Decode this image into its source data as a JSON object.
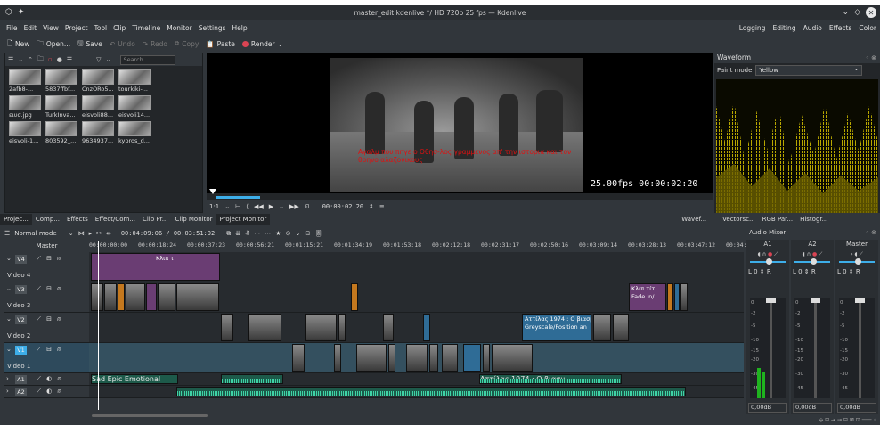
{
  "window": {
    "title": "master_edit.kdenlive */ HD 720p 25 fps — Kdenlive"
  },
  "menu": [
    "File",
    "Edit",
    "View",
    "Project",
    "Tool",
    "Clip",
    "Timeline",
    "Monitor",
    "Settings",
    "Help"
  ],
  "layouts": [
    "Logging",
    "Editing",
    "Audio",
    "Effects",
    "Color"
  ],
  "toolbar": {
    "new": "New",
    "open": "Open...",
    "save": "Save",
    "undo": "Undo",
    "redo": "Redo",
    "copy": "Copy",
    "paste": "Paste",
    "render": "Render"
  },
  "bin": {
    "search_placeholder": "Search...",
    "clips": [
      "2afb8-...",
      "5837ffbf...",
      "CnzORo5...",
      "tourkiki-...",
      "ειυσ.jpg",
      "TurkInva...",
      "eisvoli88...",
      "eisvoli14...",
      "eisvoli-1...",
      "803592_...",
      "9634937...",
      "kypros_d..."
    ]
  },
  "monitor": {
    "subtitle": "Αγαλμ που πηγε ο Οθησ-λος γραμμενος απ' την ιστορια και τον θρηνο αλαζονικους",
    "fps_timecode": "25.00fps 00:00:02:20",
    "zoom": "1:1",
    "timecode": "00:00:02:20"
  },
  "waveform": {
    "title": "Waveform",
    "paint_mode_label": "Paint mode",
    "paint_mode_value": "Yellow"
  },
  "dock_tabs": [
    "Projec...",
    "Comp...",
    "Effects",
    "Effect/Com...",
    "Clip Pr...",
    "Clip Monitor",
    "Project Monitor"
  ],
  "scope_tabs": [
    "Wavef...",
    "Vectorsc...",
    "RGB Par...",
    "Histogr..."
  ],
  "timeline": {
    "mode": "Normal mode",
    "position": "00:04:09:06 / 00:03:51:02",
    "master_label": "Master",
    "ruler": [
      "00:00:00:00",
      "00:00:18:24",
      "00:00:37:23",
      "00:00:56:21",
      "00:01:15:21",
      "00:01:34:19",
      "00:01:53:18",
      "00:02:12:18",
      "00:02:31:17",
      "00:02:50:16",
      "00:03:09:14",
      "00:03:28:13",
      "00:03:47:12",
      "00:04:"
    ],
    "tracks": [
      {
        "tag": "V4",
        "name": "Video 4"
      },
      {
        "tag": "V3",
        "name": "Video 3"
      },
      {
        "tag": "V2",
        "name": "Video 2"
      },
      {
        "tag": "V1",
        "name": "Video 1"
      },
      {
        "tag": "A1",
        "name": ""
      },
      {
        "tag": "A2",
        "name": ""
      }
    ],
    "clip_labels": {
      "v4_title": "Κλιπ τ",
      "v3_title": "Κλιπ τίτ",
      "v3_fade": "Fade in/",
      "v2_title": "Αττίλας 1974 : Ο βιασμ",
      "v2_effect": "Greyscale/Position an",
      "a1_music": "Sad Epic Emotional Musi",
      "a1_voice": "Αττίλας 1974 : Ο βιασμ"
    }
  },
  "mixer": {
    "title": "Audio Mixer",
    "strips": [
      {
        "name": "A1",
        "db": "0,00dB"
      },
      {
        "name": "A2",
        "db": "0,00dB"
      },
      {
        "name": "Master",
        "db": "0,00dB"
      }
    ],
    "scale": [
      "0",
      "-2",
      "-5",
      "-10",
      "-15",
      "-20",
      "-30",
      "-45"
    ]
  }
}
